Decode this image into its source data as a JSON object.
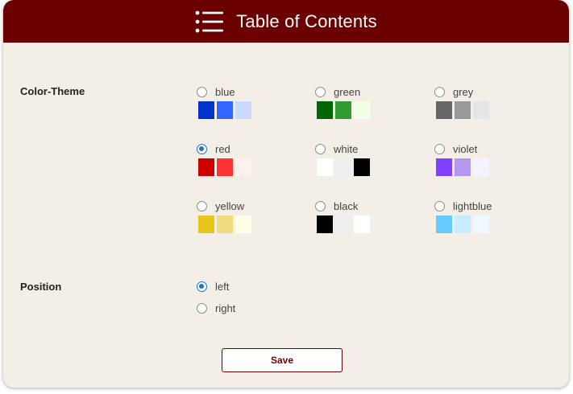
{
  "header": {
    "title": "Table of Contents",
    "icon": "list-icon",
    "bg_color": "#6b0000"
  },
  "color_theme": {
    "label": "Color-Theme",
    "selected": "red",
    "options": [
      {
        "label": "blue",
        "colors": [
          "#0033cc",
          "#3366ff",
          "#ccd9ff"
        ]
      },
      {
        "label": "green",
        "colors": [
          "#006600",
          "#339933",
          "#f2ffe6"
        ]
      },
      {
        "label": "grey",
        "colors": [
          "#666666",
          "#999999",
          "#e6e6e6"
        ]
      },
      {
        "label": "red",
        "colors": [
          "#cc0000",
          "#ff3333",
          "#fff0f0"
        ]
      },
      {
        "label": "white",
        "colors": [
          "#ffffff",
          "#eeeeee",
          "#000000"
        ]
      },
      {
        "label": "violet",
        "colors": [
          "#8040ff",
          "#b399ee",
          "#f6f2ff"
        ]
      },
      {
        "label": "yellow",
        "colors": [
          "#e6c619",
          "#f0dd80",
          "#ffffe6"
        ]
      },
      {
        "label": "black",
        "colors": [
          "#000000",
          "#eeeeee",
          "#ffffff"
        ]
      },
      {
        "label": "lightblue",
        "colors": [
          "#66ccff",
          "#c6ecff",
          "#f0f8ff"
        ]
      }
    ]
  },
  "position": {
    "label": "Position",
    "selected": "left",
    "options": [
      {
        "label": "left"
      },
      {
        "label": "right"
      }
    ]
  },
  "save_label": "Save"
}
